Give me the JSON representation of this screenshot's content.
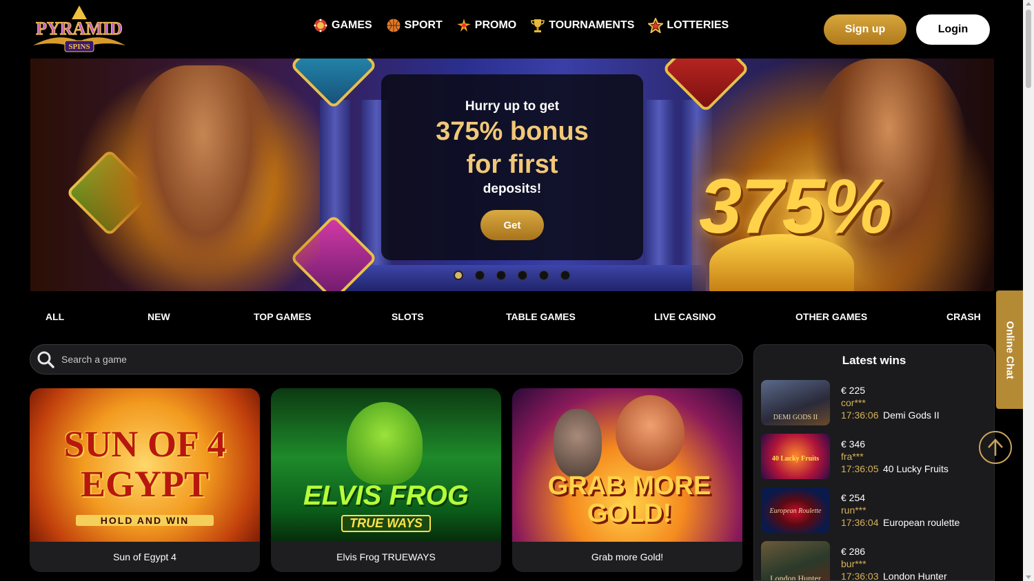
{
  "brand": {
    "logo_line1": "PYRAMID",
    "logo_line2": "SPINS"
  },
  "nav": [
    {
      "label": "GAMES",
      "icon": "poker-chip-icon"
    },
    {
      "label": "SPORT",
      "icon": "basketball-icon"
    },
    {
      "label": "PROMO",
      "icon": "sparkle-icon"
    },
    {
      "label": "TOURNAMENTS",
      "icon": "trophy-icon"
    },
    {
      "label": "LOTTERIES",
      "icon": "star-icon"
    }
  ],
  "auth": {
    "signup_label": "Sign up",
    "login_label": "Login"
  },
  "banner": {
    "line1": "Hurry up to get",
    "line2": "375% bonus",
    "line3": "for first",
    "line4": "deposits!",
    "button_label": "Get",
    "big_percent": "375%",
    "slides_total": 6,
    "active_slide": 1
  },
  "categories": [
    "ALL",
    "NEW",
    "TOP GAMES",
    "SLOTS",
    "TABLE GAMES",
    "LIVE CASINO",
    "OTHER GAMES",
    "CRASH"
  ],
  "search": {
    "placeholder": "Search a game"
  },
  "games": [
    {
      "title": "Sun of Egypt 4",
      "art_main": "SUN OF 4 EGYPT",
      "art_sub": "HOLD AND WIN"
    },
    {
      "title": "Elvis Frog TRUEWAYS",
      "art_main": "ELVIS FROG",
      "art_sub": "TRUE WAYS"
    },
    {
      "title": "Grab more Gold!",
      "art_main": "GRAB MORE GOLD!",
      "art_sub": ""
    }
  ],
  "latest_wins": {
    "title": "Latest wins",
    "items": [
      {
        "amount": "€ 225",
        "user": "cor***",
        "time": "17:36:06",
        "game": "Demi Gods II",
        "thumb_label": "DEMI GODS II"
      },
      {
        "amount": "€ 346",
        "user": "fra***",
        "time": "17:36:05",
        "game": "40 Lucky Fruits",
        "thumb_label": "40 Lucky Fruits"
      },
      {
        "amount": "€ 254",
        "user": "run***",
        "time": "17:36:04",
        "game": "European roulette",
        "thumb_label": "European Roulette"
      },
      {
        "amount": "€ 286",
        "user": "bur***",
        "time": "17:36:03",
        "game": "London Hunter",
        "thumb_label": "London Hunter"
      }
    ]
  },
  "chat": {
    "label": "Online Chat"
  },
  "colors": {
    "gold": "#d7a63c",
    "accent_text": "#d7b15a",
    "background": "#000000",
    "panel": "#1b1b1d"
  }
}
